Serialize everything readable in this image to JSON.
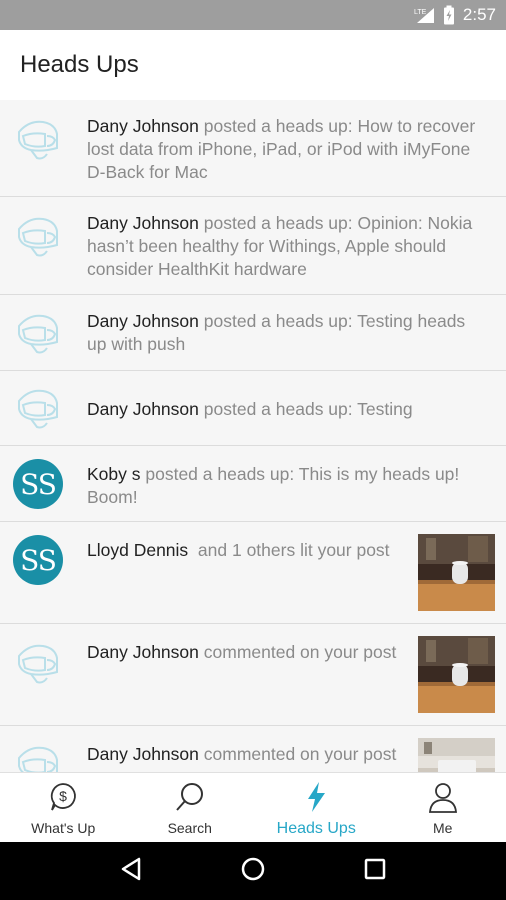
{
  "status_bar": {
    "time": "2:57",
    "network": "LTE",
    "icons": [
      "lte-signal-icon",
      "battery-icon"
    ]
  },
  "app_bar": {
    "title": "Heads Ups"
  },
  "feed": [
    {
      "avatar": "headset-icon",
      "name": "Dany Johnson",
      "action": "posted a heads up: How to recover lost data from iPhone, iPad, or iPod with iMyFone D-Back for Mac"
    },
    {
      "avatar": "headset-icon",
      "name": "Dany Johnson",
      "action": "posted a heads up: Opinion: Nokia hasn’t been healthy for Withings, Apple should consider HealthKit hardware"
    },
    {
      "avatar": "headset-icon",
      "name": "Dany Johnson",
      "action": "posted a heads up: Testing heads up with push"
    },
    {
      "avatar": "headset-icon",
      "name": "Dany Johnson",
      "action": "posted a heads up: Testing"
    },
    {
      "avatar": "SS",
      "name": "Koby s",
      "action": "posted a heads up: This is my heads up! Boom!"
    },
    {
      "avatar": "SS",
      "name": "Lloyd Dennis",
      "action": " and 1 others lit your post",
      "thumb": "homepod-photo"
    },
    {
      "avatar": "headset-icon",
      "name": "Dany Johnson",
      "action": "commented on your post",
      "thumb": "homepod-photo"
    },
    {
      "avatar": "headset-icon",
      "name": "Dany Johnson",
      "action": "commented on your post",
      "thumb": "desk-photo"
    }
  ],
  "bottom_nav": [
    {
      "label": "What's Up",
      "icon": "dollar-chat-icon",
      "active": false
    },
    {
      "label": "Search",
      "icon": "search-icon",
      "active": false
    },
    {
      "label": "Heads Ups",
      "icon": "lightning-icon",
      "active": true
    },
    {
      "label": "Me",
      "icon": "person-icon",
      "active": false
    }
  ],
  "system_nav": [
    "back-icon",
    "home-icon",
    "recents-icon"
  ],
  "colors": {
    "accent": "#27a7c7",
    "avatar_bg": "#1a8fa6",
    "status_bar": "#9e9e9e",
    "row_bg": "#f6f6f6"
  }
}
